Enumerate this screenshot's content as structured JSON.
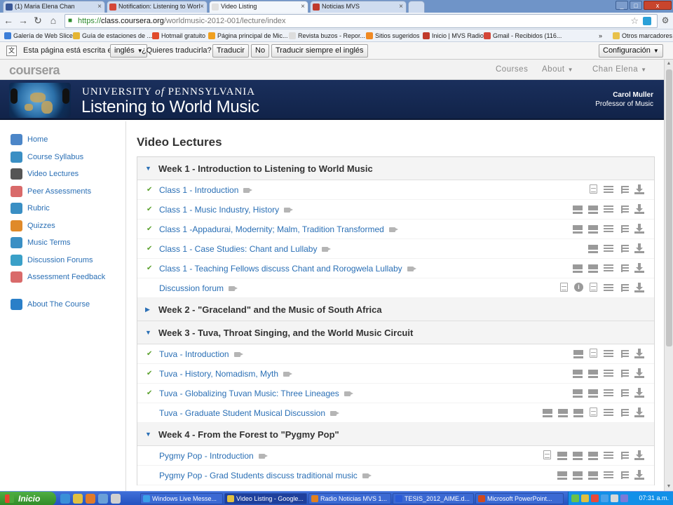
{
  "browser": {
    "tabs": [
      {
        "label": "(1) Maria Elena Chan",
        "color": "#3b5998"
      },
      {
        "label": "Notification: Listening to Worl",
        "color": "#d44638"
      },
      {
        "label": "Video Listing",
        "color": "#e0e0e0"
      },
      {
        "label": "Noticias MVS",
        "color": "#c0392b"
      }
    ],
    "url": {
      "scheme": "https://",
      "host": "class.coursera.org",
      "path": "/worldmusic-2012-001/lecture/index"
    },
    "bookmarks": [
      {
        "label": "Galería de Web Slice",
        "color": "#3b7dd8"
      },
      {
        "label": "Guía de estaciones de ...",
        "color": "#e5b533"
      },
      {
        "label": "Hotmail gratuito",
        "color": "#e04b2c"
      },
      {
        "label": "Página principal de Mic...",
        "color": "#f0a020"
      },
      {
        "label": "Revista buzos - Repor...",
        "color": "#dddddd"
      },
      {
        "label": "Sitios sugeridos",
        "color": "#f08a24"
      },
      {
        "label": "Inicio | MVS Radio",
        "color": "#c0392b"
      },
      {
        "label": "Gmail - Recibidos (116...",
        "color": "#d44638"
      }
    ],
    "bookmarks_more": "»",
    "bookmarks_other": "Otros marcadores",
    "win_min": "_",
    "win_max": "□",
    "win_close": "x"
  },
  "translate": {
    "prefix": "Esta página está escrita en",
    "language": "inglés",
    "question": "¿Quieres traducirla?",
    "translate_btn": "Traducir",
    "no_btn": "No",
    "always_btn": "Traducir siempre el inglés",
    "config_btn": "Configuración"
  },
  "coursera": {
    "logo": "coursera",
    "nav": {
      "courses": "Courses",
      "about": "About",
      "user": "Chan Elena"
    }
  },
  "banner": {
    "university_pre": "UNIVERSITY",
    "university_of": "of",
    "university_post": "PENNSYLVANIA",
    "course_title": "Listening to World Music",
    "professor_name": "Carol Muller",
    "professor_title": "Professor of Music"
  },
  "sidebar": {
    "items": [
      {
        "label": "Home",
        "color": "#4c86c8"
      },
      {
        "label": "Course Syllabus",
        "color": "#3a8fc4"
      },
      {
        "label": "Video Lectures",
        "color": "#555555"
      },
      {
        "label": "Peer Assessments",
        "color": "#d96a6a"
      },
      {
        "label": "Rubric",
        "color": "#3a8fc4"
      },
      {
        "label": "Quizzes",
        "color": "#e08a2a"
      },
      {
        "label": "Music Terms",
        "color": "#3a8fc4"
      },
      {
        "label": "Discussion Forums",
        "color": "#3aa0c8"
      },
      {
        "label": "Assessment Feedback",
        "color": "#d96a6a"
      },
      {
        "label": "About The Course",
        "color": "#2a7fc8"
      }
    ]
  },
  "main": {
    "title": "Video Lectures",
    "weeks": [
      {
        "title": "Week 1 - Introduction to Listening to World Music",
        "expanded": true,
        "lectures": [
          {
            "title": "Class 1 - Introduction",
            "watched": true,
            "resources": [
              "doc",
              "list",
              "blist",
              "dl"
            ]
          },
          {
            "title": "Class 1 - Music Industry, History",
            "watched": true,
            "resources": [
              "slides",
              "slides",
              "list",
              "blist",
              "dl"
            ]
          },
          {
            "title": "Class 1 -Appadurai, Modernity; Malm, Tradition Transformed",
            "watched": true,
            "resources": [
              "slides",
              "slides",
              "list",
              "blist",
              "dl"
            ]
          },
          {
            "title": "Class 1 - Case Studies: Chant and Lullaby",
            "watched": true,
            "resources": [
              "slides",
              "list",
              "blist",
              "dl"
            ]
          },
          {
            "title": "Class 1 - Teaching Fellows discuss Chant and Rorogwela Lullaby",
            "watched": true,
            "resources": [
              "slides",
              "slides",
              "list",
              "blist",
              "dl"
            ]
          },
          {
            "title": "Discussion forum",
            "watched": false,
            "resources": [
              "doc",
              "info",
              "doc",
              "list",
              "blist",
              "dl"
            ]
          }
        ]
      },
      {
        "title": "Week 2 - \"Graceland\" and the Music of South Africa",
        "expanded": false,
        "lectures": []
      },
      {
        "title": "Week 3 - Tuva, Throat Singing, and the World Music Circuit",
        "expanded": true,
        "lectures": [
          {
            "title": "Tuva - Introduction",
            "watched": true,
            "resources": [
              "slides",
              "doc",
              "list",
              "blist",
              "dl"
            ]
          },
          {
            "title": "Tuva - History, Nomadism, Myth",
            "watched": true,
            "resources": [
              "slides",
              "slides",
              "list",
              "blist",
              "dl"
            ]
          },
          {
            "title": "Tuva - Globalizing Tuvan Music: Three Lineages",
            "watched": true,
            "resources": [
              "slides",
              "slides",
              "list",
              "blist",
              "dl"
            ]
          },
          {
            "title": "Tuva - Graduate Student Musical Discussion",
            "watched": false,
            "resources": [
              "slides",
              "slides",
              "slides",
              "doc",
              "list",
              "blist",
              "dl"
            ]
          }
        ]
      },
      {
        "title": "Week 4 - From the Forest to \"Pygmy Pop\"",
        "expanded": true,
        "lectures": [
          {
            "title": "Pygmy Pop - Introduction",
            "watched": false,
            "resources": [
              "doc",
              "slides",
              "slides",
              "slides",
              "list",
              "blist",
              "dl"
            ]
          },
          {
            "title": "Pygmy Pop - Grad Students discuss traditional music",
            "watched": false,
            "resources": [
              "slides",
              "slides",
              "slides",
              "list",
              "blist",
              "dl"
            ]
          }
        ]
      }
    ]
  },
  "taskbar": {
    "start": "Inicio",
    "tasks": [
      {
        "label": "Windows Live Messe...",
        "color": "#3aa0e8"
      },
      {
        "label": "Video Listing - Google...",
        "color": "#e0c040"
      },
      {
        "label": "Radio Noticias MVS 1...",
        "color": "#e08020"
      },
      {
        "label": "TESIS_2012_AIME.d...",
        "color": "#2a5bd7"
      },
      {
        "label": "Microsoft PowerPoint...",
        "color": "#d04a20"
      }
    ],
    "clock": "07:31 a.m."
  }
}
